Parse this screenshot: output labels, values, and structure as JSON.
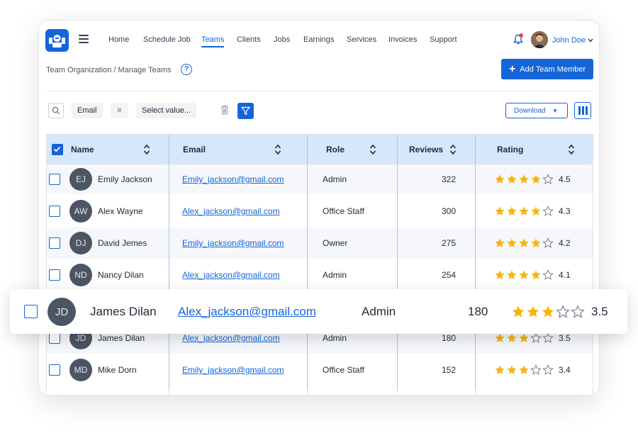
{
  "nav": {
    "items": [
      {
        "label": "Home",
        "active": false
      },
      {
        "label": "Schedule Job",
        "active": false
      },
      {
        "label": "Teams",
        "active": true
      },
      {
        "label": "Clients",
        "active": false
      },
      {
        "label": "Jobs",
        "active": false
      },
      {
        "label": "Earnings",
        "active": false
      },
      {
        "label": "Services",
        "active": false
      },
      {
        "label": "Invoices",
        "active": false
      },
      {
        "label": "Support",
        "active": false
      }
    ]
  },
  "user": {
    "name": "John Doe"
  },
  "page": {
    "breadcrumb": "Team Organization / Manage Teams",
    "help": "?",
    "add_button": "Add Team Member"
  },
  "filters": {
    "field": "Email",
    "operator": "=",
    "value_placeholder": "Select value..."
  },
  "toolbar": {
    "download_label": "Download"
  },
  "table": {
    "columns": [
      "Name",
      "Email",
      "Role",
      "Reviews",
      "Rating"
    ],
    "rows": [
      {
        "initials": "EJ",
        "name": "Emily Jackson",
        "email": "Emily_jackson@gmail.com",
        "role": "Admin",
        "reviews": "322",
        "rating": "4.5"
      },
      {
        "initials": "AW",
        "name": "Alex Wayne",
        "email": "Alex_jackson@gmail.com",
        "role": "Office Staff",
        "reviews": "300",
        "rating": "4.3"
      },
      {
        "initials": "DJ",
        "name": "David Jemes",
        "email": "Emily_jackson@gmail.com",
        "role": "Owner",
        "reviews": "275",
        "rating": "4.2"
      },
      {
        "initials": "ND",
        "name": "Nancy Dilan",
        "email": "Alex_jackson@gmail.com",
        "role": "Admin",
        "reviews": "254",
        "rating": "4.1"
      },
      {
        "initials": "JD",
        "name": "James Dilan",
        "email": "Alex_jackson@gmail.com",
        "role": "Admin",
        "reviews": "180",
        "rating": "3.5"
      },
      {
        "initials": "MD",
        "name": "Mike Dorn",
        "email": "Emily_jackson@gmail.com",
        "role": "Office Staff",
        "reviews": "152",
        "rating": "3.4"
      }
    ]
  },
  "highlight": {
    "initials": "JD",
    "name": "James Dilan",
    "email": "Alex_jackson@gmail.com",
    "role": "Admin",
    "reviews": "180",
    "rating": "3.5"
  },
  "colors": {
    "accent": "#1565d8",
    "star": "#f5b50a",
    "header_bg": "#d6e6fb"
  }
}
